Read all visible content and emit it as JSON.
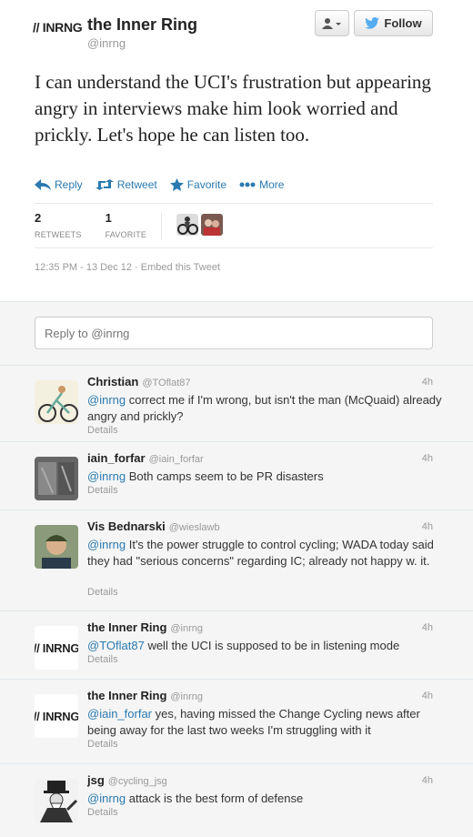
{
  "tweet": {
    "logo_text": "// INRNG",
    "author_name": "the Inner Ring",
    "author_handle": "@inrng",
    "follow_label": "Follow",
    "text": "I can understand the UCI's frustration but appearing angry in interviews make him look worried and prickly. Let's hope he can listen too.",
    "actions": {
      "reply": "Reply",
      "retweet": "Retweet",
      "favorite": "Favorite",
      "more": "More"
    },
    "retweets_count": "2",
    "retweets_label": "RETWEETS",
    "favorites_count": "1",
    "favorites_label": "FAVORITE",
    "timestamp": "12:35 PM - 13 Dec 12 · Embed this Tweet"
  },
  "reply_box": {
    "placeholder": "Reply to @inrng"
  },
  "replies": [
    {
      "name": "Christian",
      "handle": "@TOflat87",
      "time": "4h",
      "mention": "@inrng",
      "text": " correct me if I'm wrong, but isn't the man (McQuaid) already angry and prickly?",
      "details": "Details"
    },
    {
      "name": "iain_forfar",
      "handle": "@iain_forfar",
      "time": "4h",
      "mention": "@inrng",
      "text": " Both camps seem to be PR disasters",
      "details": "Details"
    },
    {
      "name": "Vis Bednarski",
      "handle": "@wieslawb",
      "time": "4h",
      "mention": "@inrng",
      "text": " It's the power struggle to control cycling; WADA today said they had \"serious concerns\" regarding IC; already not happy w. it.",
      "details": "Details"
    },
    {
      "name": "the Inner Ring",
      "handle": "@inrng",
      "time": "4h",
      "mention": "@TOflat87",
      "text": " well the UCI is supposed to be in listening mode",
      "details": "Details",
      "logo": "// INRNG"
    },
    {
      "name": "the Inner Ring",
      "handle": "@inrng",
      "time": "4h",
      "mention": "@iain_forfar",
      "text": " yes, having missed the Change Cycling news after being away for the last two weeks I'm struggling with it",
      "details": "Details",
      "logo": "// INRNG"
    },
    {
      "name": "jsg",
      "handle": "@cycling_jsg",
      "time": "4h",
      "mention": "@inrng",
      "text": " attack is the best form of defense",
      "details": "Details"
    }
  ],
  "colors": {
    "link": "#2a7ab0",
    "follow_bird": "#55acee",
    "background": "#f5f5f5"
  }
}
